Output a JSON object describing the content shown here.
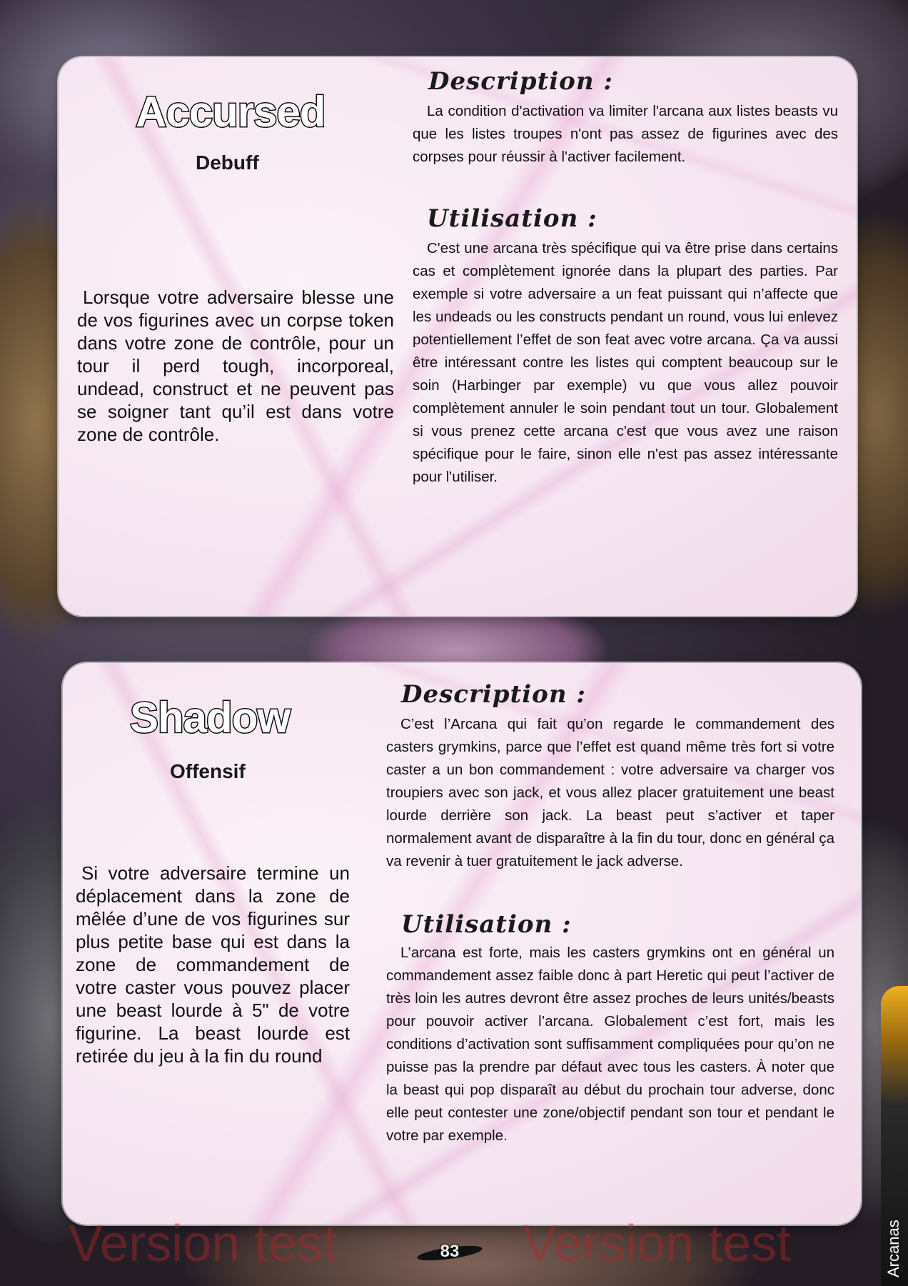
{
  "cards": [
    {
      "name": "Accursed",
      "type": "Debuff",
      "effect": "Lorsque votre adversaire blesse une de vos figurines avec un corpse token dans votre zone de contrôle, pour un tour il perd tough, incorporeal, undead, construct et ne peuvent pas se soigner tant qu’il est dans votre zone de contrôle.",
      "description_heading": "Description :",
      "description": "La condition d'activation va limiter l'arcana aux listes beasts vu que les listes troupes n'ont pas assez de figurines avec des corpses pour réussir à l'activer facilement.",
      "utilisation_heading": "Utilisation :",
      "utilisation": "C'est une arcana très spécifique qui va être prise dans certains cas et complètement ignorée dans la plupart des parties. Par exemple si votre adversaire a un feat puissant qui n’affecte que les undeads ou les constructs pendant un round, vous lui enlevez potentiellement l’effet de son feat avec votre arcana. Ça va aussi être intéressant contre les listes qui comptent beaucoup sur le soin (Harbinger par exemple) vu que vous allez pouvoir complètement annuler le soin pendant tout un tour. Globalement si vous prenez cette arcana c'est que vous avez une raison spécifique pour le faire, sinon elle n'est pas assez intéressante pour l'utiliser."
    },
    {
      "name": "Shadow",
      "type": "Offensif",
      "effect": "Si votre adversaire termine un déplacement dans la zone de mêlée d’une de vos figurines sur plus petite base qui est dans la zone de commandement de votre caster vous pouvez placer une beast lourde à 5\" de votre figurine. La beast lourde est retirée du jeu à la fin du round",
      "description_heading": "Description :",
      "description": "C’est l’Arcana qui fait qu’on regarde le commandement des casters grymkins, parce que l’effet est quand même très fort si votre caster a un bon commandement : votre adversaire va charger vos troupiers avec son jack, et vous allez placer gratuitement une beast lourde derrière son jack. La beast peut s’activer et taper normalement avant de disparaître à la fin du tour, donc en général ça va revenir à tuer gratuitement le jack adverse.",
      "utilisation_heading": "Utilisation :",
      "utilisation": "L’arcana est forte, mais les casters grymkins ont en général un commandement assez faible donc à part Heretic qui peut l’activer de très loin les autres devront être assez proches de leurs unités/beasts pour pouvoir activer l’arcana. Globalement c’est fort, mais les conditions d’activation sont suffisamment compliquées pour qu’on ne puisse pas la prendre par défaut avec tous les casters. À noter que la beast qui pop disparaît au début du prochain tour adverse, donc elle peut contester une zone/objectif pendant son tour et pendant le votre par exemple."
    }
  ],
  "side_tab": "Arcanas",
  "watermark": "Version test",
  "page_number": "83"
}
